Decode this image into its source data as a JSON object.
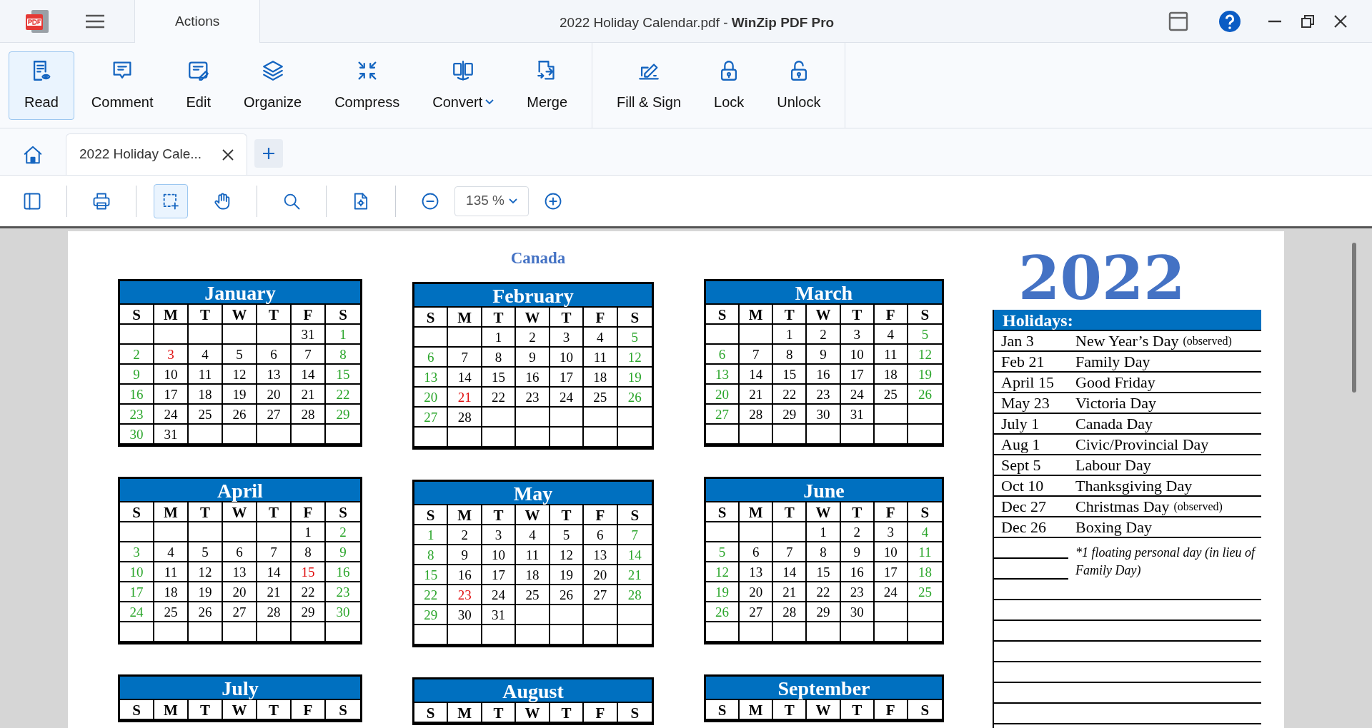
{
  "window": {
    "title_file": "2022 Holiday Calendar.pdf - ",
    "title_app": "WinZip PDF Pro"
  },
  "top_tabs": [
    {
      "label": "Actions",
      "selected": true
    }
  ],
  "ribbon_groups": [
    [
      {
        "label": "Read",
        "selected": true,
        "dropdown": false
      },
      {
        "label": "Comment",
        "selected": false,
        "dropdown": false
      },
      {
        "label": "Edit",
        "selected": false,
        "dropdown": false
      },
      {
        "label": "Organize",
        "selected": false,
        "dropdown": false
      },
      {
        "label": "Compress",
        "selected": false,
        "dropdown": false
      },
      {
        "label": "Convert",
        "selected": false,
        "dropdown": true
      },
      {
        "label": "Merge",
        "selected": false,
        "dropdown": false
      }
    ],
    [
      {
        "label": "Fill & Sign",
        "selected": false,
        "dropdown": false
      },
      {
        "label": "Lock",
        "selected": false,
        "dropdown": false
      },
      {
        "label": "Unlock",
        "selected": false,
        "dropdown": false
      }
    ]
  ],
  "doc_tabs": [
    {
      "label": "2022 Holiday Cale...",
      "selected": true
    }
  ],
  "toolbar": {
    "select_tool_selected": true,
    "zoom": "135 %"
  },
  "document": {
    "country": "Canada",
    "year": "2022",
    "months": [
      {
        "name": "January",
        "weekdays": [
          "S",
          "M",
          "T",
          "W",
          "T",
          "F",
          "S"
        ],
        "weeks": [
          [
            "31",
            "1"
          ],
          [
            "2",
            {
              "day": "3",
              "kind": "holiday"
            },
            "4",
            "5",
            "6",
            "7",
            "8"
          ],
          [
            "9",
            "10",
            "11",
            "12",
            "13",
            "14",
            "15"
          ],
          [
            "16",
            "17",
            "18",
            "19",
            "20",
            "21",
            "22"
          ],
          [
            "23",
            "24",
            "25",
            "26",
            "27",
            "28",
            "29"
          ],
          [
            "30",
            "31"
          ]
        ]
      },
      {
        "name": "February",
        "weekdays": [
          "S",
          "M",
          "T",
          "W",
          "T",
          "F",
          "S"
        ],
        "weeks": [
          [
            "1",
            "2",
            "3",
            "4",
            "5"
          ],
          [
            "6",
            "7",
            "8",
            "9",
            "10",
            "11",
            "12"
          ],
          [
            "13",
            "14",
            "15",
            "16",
            "17",
            "18",
            "19"
          ],
          [
            "20",
            {
              "day": "21",
              "kind": "holiday"
            },
            "22",
            "23",
            "24",
            "25",
            "26"
          ],
          [
            "27",
            "28"
          ]
        ]
      },
      {
        "name": "March",
        "weekdays": [
          "S",
          "M",
          "T",
          "W",
          "T",
          "F",
          "S"
        ],
        "weeks": [
          [
            "1",
            "2",
            "3",
            "4",
            "5"
          ],
          [
            "6",
            "7",
            "8",
            "9",
            "10",
            "11",
            "12"
          ],
          [
            "13",
            "14",
            "15",
            "16",
            "17",
            "18",
            "19"
          ],
          [
            "20",
            "21",
            "22",
            "23",
            "24",
            "25",
            "26"
          ],
          [
            "27",
            "28",
            "29",
            "30",
            "31"
          ]
        ]
      },
      {
        "name": "April",
        "weekdays": [
          "S",
          "M",
          "T",
          "W",
          "T",
          "F",
          "S"
        ],
        "weeks": [
          [
            "1",
            "2"
          ],
          [
            "3",
            "4",
            "5",
            "6",
            "7",
            "8",
            "9"
          ],
          [
            "10",
            "11",
            "12",
            "13",
            "14",
            {
              "day": "15",
              "kind": "holiday"
            },
            "16"
          ],
          [
            "17",
            "18",
            "19",
            "20",
            "21",
            "22",
            "23"
          ],
          [
            "24",
            "25",
            "26",
            "27",
            "28",
            "29",
            "30"
          ]
        ]
      },
      {
        "name": "May",
        "weekdays": [
          "S",
          "M",
          "T",
          "W",
          "T",
          "F",
          "S"
        ],
        "weeks": [
          [
            "1",
            "2",
            "3",
            "4",
            "5",
            "6",
            "7"
          ],
          [
            "8",
            "9",
            "10",
            "11",
            "12",
            "13",
            "14"
          ],
          [
            "15",
            "16",
            "17",
            "18",
            "19",
            "20",
            "21"
          ],
          [
            "22",
            {
              "day": "23",
              "kind": "holiday"
            },
            "24",
            "25",
            "26",
            "27",
            "28"
          ],
          [
            "29",
            "30",
            "31"
          ]
        ]
      },
      {
        "name": "June",
        "weekdays": [
          "S",
          "M",
          "T",
          "W",
          "T",
          "F",
          "S"
        ],
        "weeks": [
          [
            "1",
            "2",
            "3",
            "4"
          ],
          [
            "5",
            "6",
            "7",
            "8",
            "9",
            "10",
            "11"
          ],
          [
            "12",
            "13",
            "14",
            "15",
            "16",
            "17",
            "18"
          ],
          [
            "19",
            "20",
            "21",
            "22",
            "23",
            "24",
            "25"
          ],
          [
            "26",
            "27",
            "28",
            "29",
            "30"
          ]
        ]
      },
      {
        "name": "July",
        "weekdays": [
          "S",
          "M",
          "T",
          "W",
          "T",
          "F",
          "S"
        ]
      },
      {
        "name": "August",
        "weekdays": [
          "S",
          "M",
          "T",
          "W",
          "T",
          "F",
          "S"
        ]
      },
      {
        "name": "September",
        "weekdays": [
          "S",
          "M",
          "T",
          "W",
          "T",
          "F",
          "S"
        ]
      }
    ],
    "holidays_title": "Holidays:",
    "holidays": [
      {
        "date": "Jan 3",
        "name": "New Year’s Day",
        "note": "(observed)"
      },
      {
        "date": "Feb 21",
        "name": "Family Day"
      },
      {
        "date": "April 15",
        "name": "Good Friday"
      },
      {
        "date": "May 23",
        "name": "Victoria Day"
      },
      {
        "date": "July 1",
        "name": "Canada Day"
      },
      {
        "date": "Aug 1",
        "name": "Civic/Provincial Day"
      },
      {
        "date": "Sept 5",
        "name": "Labour Day"
      },
      {
        "date": "Oct 10",
        "name": "Thanksgiving Day"
      },
      {
        "date": "Dec 27",
        "name": "Christmas Day",
        "note": "(observed)"
      },
      {
        "date": "Dec 26",
        "name": "Boxing Day"
      }
    ],
    "footnote": "*1 floating personal day (in lieu of Family Day)"
  }
}
